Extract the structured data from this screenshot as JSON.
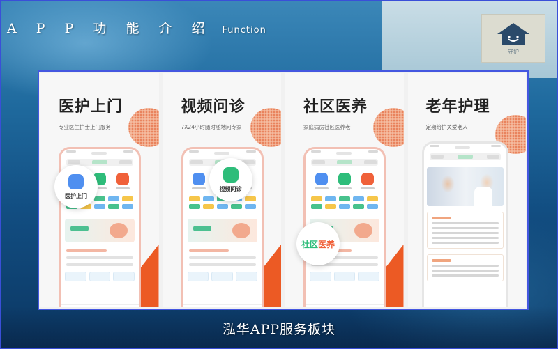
{
  "header": {
    "title": "A P P 功 能 介 绍",
    "subtitle": "Function"
  },
  "logo": {
    "text": "守护"
  },
  "cards": [
    {
      "title": "医护上门",
      "subtitle": "专业医生护士上门服务",
      "highlight": "医护上门"
    },
    {
      "title": "视频问诊",
      "subtitle": "7X24小时随时随地问专家",
      "highlight": "视频问诊"
    },
    {
      "title": "社区医养",
      "subtitle": "家庭病房社区医养老",
      "highlight_a": "社区",
      "highlight_b": "医养"
    },
    {
      "title": "老年护理",
      "subtitle": "定期给护关爱老人"
    }
  ],
  "footer": {
    "caption": "泓华APP服务板块"
  },
  "colors": {
    "panel_border": "#4457e0",
    "accent_orange": "#ec5a24",
    "accent_green": "#2ebd7a",
    "accent_blue": "#4f8ff0"
  }
}
